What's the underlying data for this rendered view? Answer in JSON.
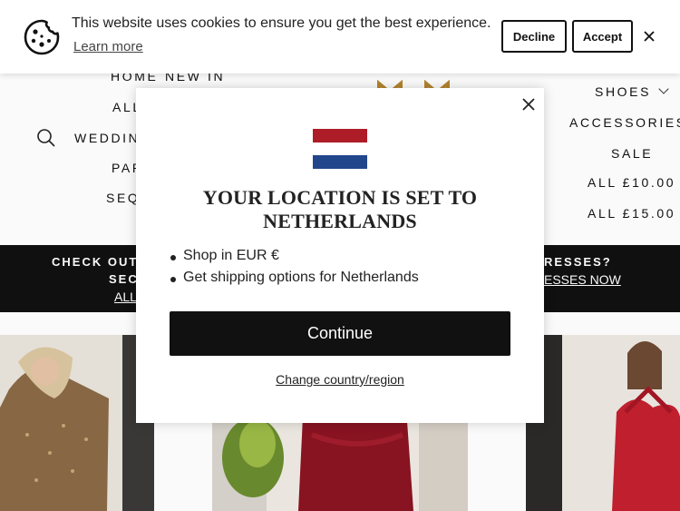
{
  "cookie_bar": {
    "message": "This website uses cookies to ensure you get the best experience.",
    "learn_more": "Learn more",
    "decline": "Decline",
    "accept": "Accept",
    "icon": "cookie-icon",
    "close_icon": "close-icon"
  },
  "nav_left": {
    "home": "HOME",
    "new_in": "NEW IN",
    "all": "ALL",
    "wedding": "WEDDING",
    "party": "PAR",
    "sequin": "SEQU"
  },
  "nav_right": {
    "shoes": "SHOES",
    "accessories": "ACCESSORIES",
    "sale": "SALE",
    "all_10": "ALL £10.00",
    "all_15": "ALL £15.00"
  },
  "announcement": {
    "left_line1": "CHECK OUT O",
    "left_line2": "SECT",
    "left_link": "ALL",
    "right_line1": "RESSES?",
    "right_link": "ESSES NOW"
  },
  "modal": {
    "title_line1": "YOUR LOCATION IS SET TO",
    "title_line2": "NETHERLANDS",
    "bullets": [
      "Shop in EUR €",
      "Get shipping options for Netherlands"
    ],
    "continue": "Continue",
    "change": "Change country/region",
    "flag_colors": [
      "#AE1C28",
      "#FFFFFF",
      "#21468B"
    ]
  },
  "colors": {
    "dark": "#111111",
    "accent_logo": "#B8862E"
  }
}
